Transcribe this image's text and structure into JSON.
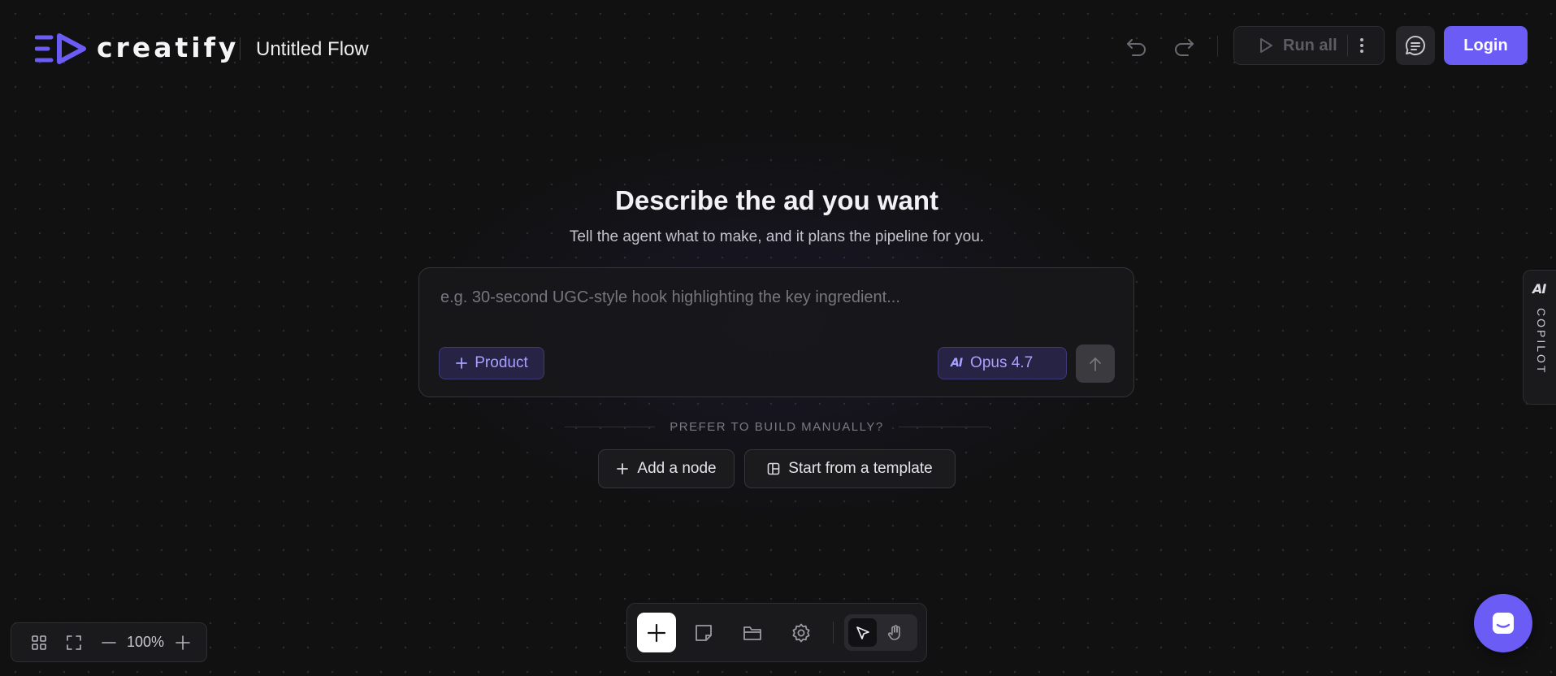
{
  "header": {
    "brand": "creatify",
    "flow_title": "Untitled Flow",
    "undo_icon": "undo-icon",
    "redo_icon": "redo-icon",
    "run_all_label": "Run all",
    "more_icon": "more-vertical-icon",
    "chat_icon": "chat-icon",
    "login_label": "Login"
  },
  "hero": {
    "title": "Describe the ad you want",
    "subtitle": "Tell the agent what to make, and it plans the pipeline for you."
  },
  "prompt": {
    "placeholder": "e.g. 30-second UGC-style hook highlighting the key ingredient...",
    "value": "",
    "product_chip": "Product",
    "model_badge": "AI",
    "model_label": "Opus 4.7",
    "send_icon": "arrow-up-icon"
  },
  "manual": {
    "divider_text": "PREFER TO BUILD MANUALLY?",
    "add_node_label": "Add a node",
    "template_label": "Start from a template"
  },
  "copilot": {
    "badge": "AI",
    "label": "COPILOT"
  },
  "zoom": {
    "value": "100%"
  },
  "toolbar": {
    "items": [
      "plus-icon",
      "sticky-note-icon",
      "folder-icon",
      "settings-icon",
      "pointer-icon",
      "hand-icon"
    ]
  },
  "colors": {
    "accent": "#6b5cf6",
    "background": "#111112",
    "chip_text": "#a9a1ff"
  }
}
